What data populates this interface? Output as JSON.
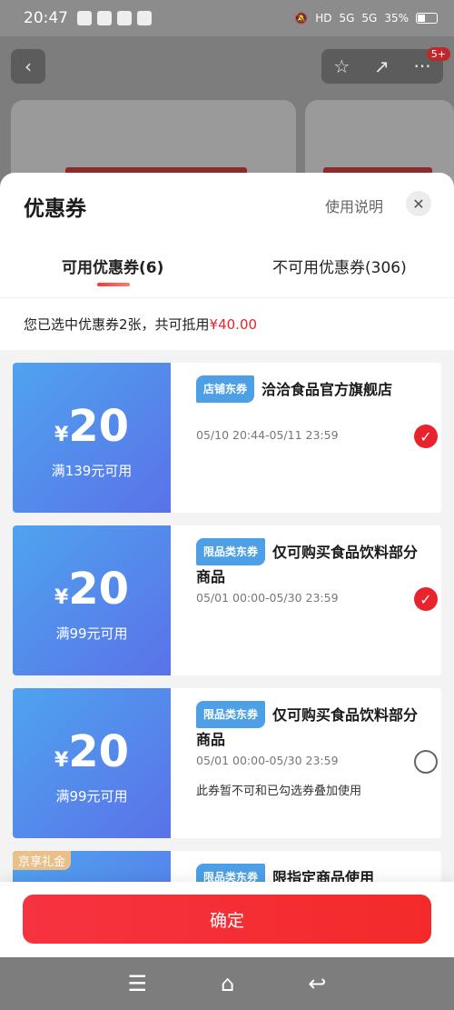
{
  "status_bar": {
    "time": "20:47",
    "network_labels": [
      "HD",
      "5G",
      "5G"
    ],
    "battery": "35%"
  },
  "background_page": {
    "back_icon": "‹",
    "star_icon": "☆",
    "share_icon": "↗",
    "more_icon": "···",
    "badge": "5+"
  },
  "sheet": {
    "title": "优惠券",
    "help_link": "使用说明",
    "close_icon": "✕",
    "tabs": [
      {
        "label": "可用优惠券(6)",
        "active": true
      },
      {
        "label": "不可用优惠券(306)",
        "active": false
      }
    ],
    "summary": {
      "prefix": "您已选中优惠券2张，共可抵用",
      "amount": "¥40.00"
    },
    "coupons": [
      {
        "currency": "¥",
        "amount": "20",
        "threshold": "满139元可用",
        "tag": "店铺东券",
        "title": "洽洽食品官方旗舰店",
        "validity": "05/10 20:44-05/11 23:59",
        "note": "",
        "checked": true,
        "gift_tag": ""
      },
      {
        "currency": "¥",
        "amount": "20",
        "threshold": "满99元可用",
        "tag": "限品类东券",
        "title": "仅可购买食品饮料部分商品",
        "validity": "05/01 00:00-05/30 23:59",
        "note": "",
        "checked": true,
        "gift_tag": ""
      },
      {
        "currency": "¥",
        "amount": "20",
        "threshold": "满99元可用",
        "tag": "限品类东券",
        "title": "仅可购买食品饮料部分商品",
        "validity": "05/01 00:00-05/30 23:59",
        "note": "此券暂不可和已勾选券叠加使用",
        "checked": false,
        "gift_tag": ""
      },
      {
        "currency": "",
        "amount": "",
        "threshold": "",
        "tag": "限品类东券",
        "title": "限指定商品使用",
        "validity": "",
        "note": "",
        "checked": false,
        "gift_tag": "京享礼金"
      }
    ],
    "confirm_button": "确定"
  },
  "nav_bar": {
    "menu_icon": "☰",
    "home_icon": "⌂",
    "back_icon": "↩"
  },
  "colors": {
    "accent": "#e8232d",
    "coupon_blue": "#4fa3ef",
    "tag_blue": "#4d9fe6"
  }
}
